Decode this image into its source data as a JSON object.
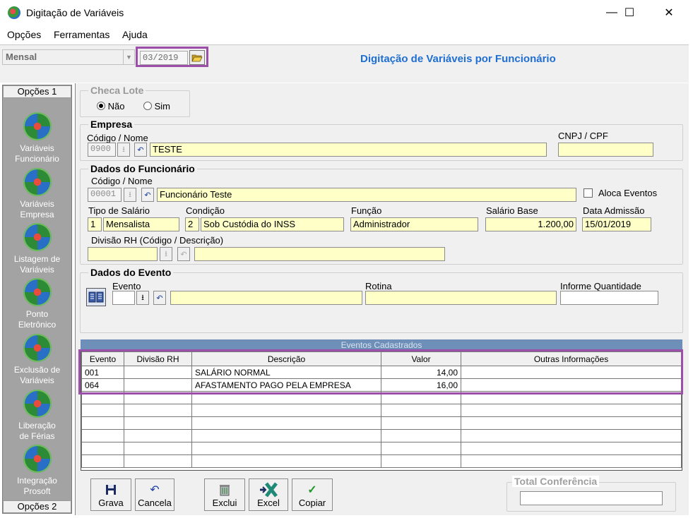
{
  "window": {
    "title": "Digitação de Variáveis",
    "minimize": "—",
    "maximize": "☐",
    "close": "✕"
  },
  "menu": [
    "Opções",
    "Ferramentas",
    "Ajuda"
  ],
  "toolbar": {
    "periodicity": "Mensal",
    "period": "03/2019",
    "heading": "Digitação de Variáveis por Funcionário"
  },
  "sidebar": {
    "tab_top": "Opções 1",
    "tab_bottom": "Opções 2",
    "items": [
      {
        "line1": "Variáveis",
        "line2": "Funcionário"
      },
      {
        "line1": "Variáveis",
        "line2": "Empresa"
      },
      {
        "line1": "Listagem de",
        "line2": "Variáveis"
      },
      {
        "line1": "Ponto",
        "line2": "Eletrônico"
      },
      {
        "line1": "Exclusão de",
        "line2": "Variáveis"
      },
      {
        "line1": "Liberação",
        "line2": "de Férias"
      },
      {
        "line1": "Integração",
        "line2": "Prosoft"
      }
    ]
  },
  "checa_lote": {
    "title": "Checa Lote",
    "option_no": "Não",
    "option_yes": "Sim",
    "selected": "Não"
  },
  "empresa": {
    "title": "Empresa",
    "code_name_label": "Código / Nome",
    "code": "0900",
    "name": "TESTE",
    "cnpj_label": "CNPJ / CPF",
    "cnpj": ""
  },
  "funcionario": {
    "title": "Dados do Funcionário",
    "code_name_label": "Código / Nome",
    "code": "00001",
    "name": "Funcionário Teste",
    "aloca_label": "Aloca Eventos",
    "aloca_checked": false,
    "tipo_label": "Tipo de Salário",
    "tipo_code": "1",
    "tipo_desc": "Mensalista",
    "condicao_label": "Condição",
    "condicao_code": "2",
    "condicao_desc": "Sob Custódia do INSS",
    "funcao_label": "Função",
    "funcao": "Administrador",
    "salario_label": "Salário Base",
    "salario": "1.200,00",
    "admissao_label": "Data Admissão",
    "admissao": "15/01/2019",
    "divisao_label": "Divisão RH (Código / Descrição)",
    "divisao_code": "",
    "divisao_desc": ""
  },
  "evento": {
    "title": "Dados do Evento",
    "evento_label": "Evento",
    "evento_code": "",
    "evento_desc": "",
    "rotina_label": "Rotina",
    "rotina": "",
    "qtd_label": "Informe Quantidade",
    "qtd": ""
  },
  "grid": {
    "caption": "Eventos Cadastrados",
    "columns": [
      "Evento",
      "Divisão RH",
      "Descrição",
      "Valor",
      "Outras Informações"
    ],
    "rows": [
      [
        "001",
        "",
        "SALÁRIO NORMAL",
        "14,00",
        ""
      ],
      [
        "064",
        "",
        "AFASTAMENTO PAGO PELA EMPRESA",
        "16,00",
        ""
      ]
    ]
  },
  "buttons": {
    "grava": "Grava",
    "cancela": "Cancela",
    "exclui": "Exclui",
    "excel": "Excel",
    "copiar": "Copiar"
  },
  "total": {
    "title": "Total Conferência",
    "value": ""
  },
  "colors": {
    "heading": "#1f6ed1",
    "highlight": "#9b4fa8",
    "field_yellow": "#ffffc8",
    "sidebar": "#a3a3a3"
  }
}
